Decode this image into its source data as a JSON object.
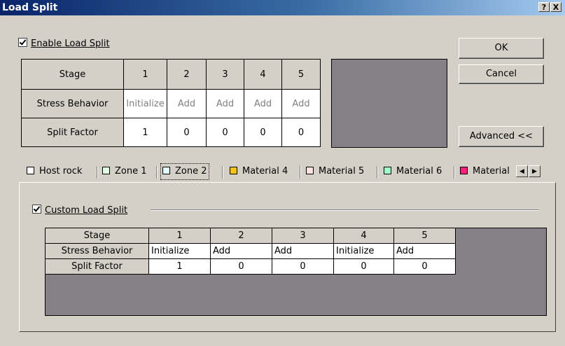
{
  "window": {
    "title": "Load Split",
    "help_button": "?",
    "close_button": "X"
  },
  "enable_load_split": {
    "label": "Enable Load Split",
    "checked": true
  },
  "buttons": {
    "ok": "OK",
    "cancel": "Cancel",
    "advanced": "Advanced <<"
  },
  "top_table": {
    "row_labels": [
      "Stage",
      "Stress Behavior",
      "Split Factor"
    ],
    "stages": [
      "1",
      "2",
      "3",
      "4",
      "5"
    ],
    "stress_behavior": [
      "Initialize",
      "Add",
      "Add",
      "Add",
      "Add"
    ],
    "split_factor": [
      "1",
      "0",
      "0",
      "0",
      "0"
    ]
  },
  "tabs": [
    {
      "label": "Host rock",
      "color": "#ffffff"
    },
    {
      "label": "Zone 1",
      "color": "#e0ffe0"
    },
    {
      "label": "Zone 2",
      "color": "#e0ffff",
      "selected": true
    },
    {
      "label": "Material 4",
      "color": "#ffc020"
    },
    {
      "label": "Material 5",
      "color": "#ffe0e0"
    },
    {
      "label": "Material 6",
      "color": "#a0ffc8"
    },
    {
      "label": "Material",
      "color": "#ff2080"
    }
  ],
  "tab_scroll": {
    "left_icon": "◀",
    "right_icon": "▶"
  },
  "custom_load_split": {
    "label": "Custom Load Split",
    "checked": true
  },
  "bottom_table": {
    "row_labels": [
      "Stage",
      "Stress Behavior",
      "Split Factor"
    ],
    "stages": [
      "1",
      "2",
      "3",
      "4",
      "5"
    ],
    "stress_behavior": [
      "Initialize",
      "Add",
      "Add",
      "Initialize",
      "Add"
    ],
    "split_factor": [
      "1",
      "0",
      "0",
      "0",
      "0"
    ]
  }
}
